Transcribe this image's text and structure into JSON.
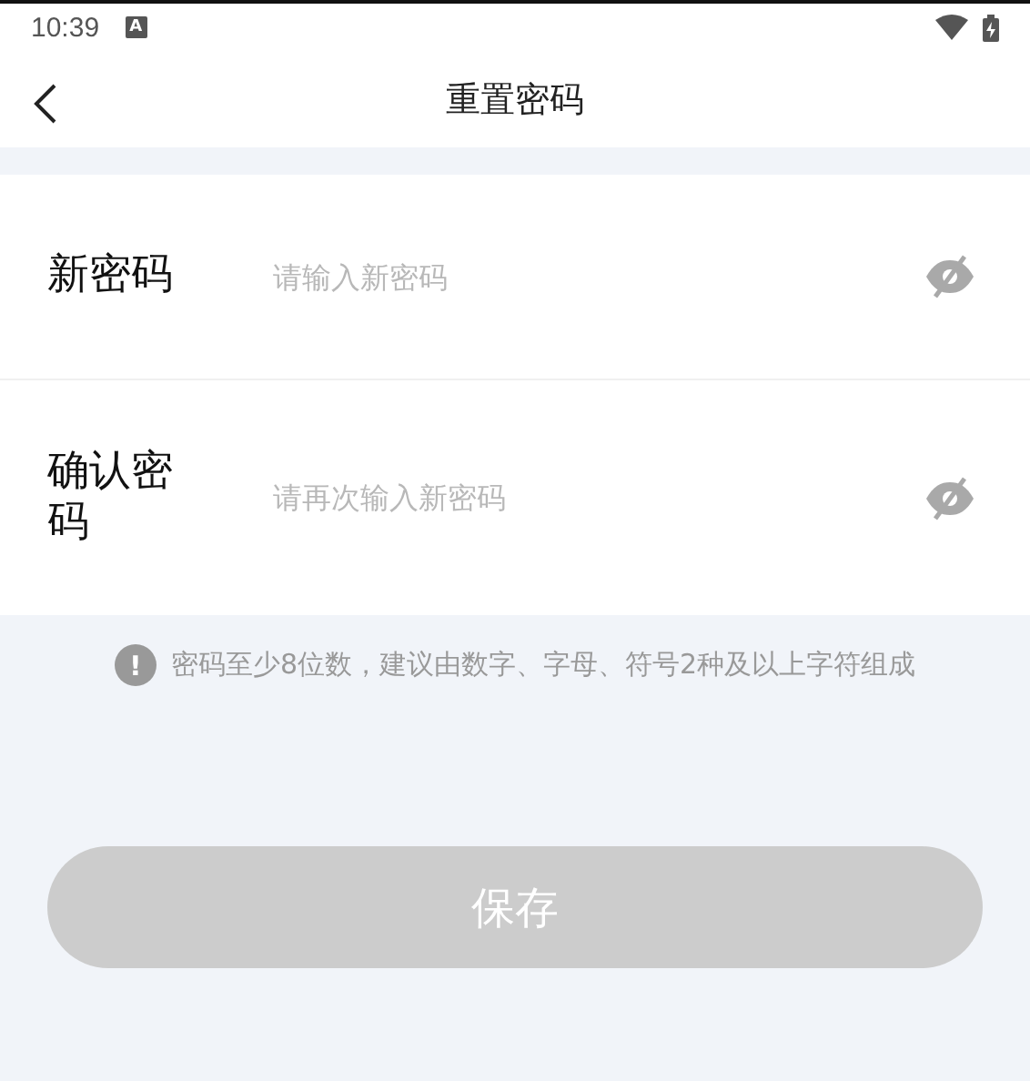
{
  "status_bar": {
    "time": "10:39",
    "notification": "A"
  },
  "header": {
    "title": "重置密码"
  },
  "fields": [
    {
      "label": "新密码",
      "placeholder": "请输入新密码",
      "visible": false
    },
    {
      "label": "确认密码",
      "placeholder": "请再次输入新密码",
      "visible": false
    }
  ],
  "notice": {
    "icon": "!",
    "text": "密码至少8位数，建议由数字、字母、符号2种及以上字符组成"
  },
  "save_button": {
    "label": "保存",
    "disabled": true
  }
}
